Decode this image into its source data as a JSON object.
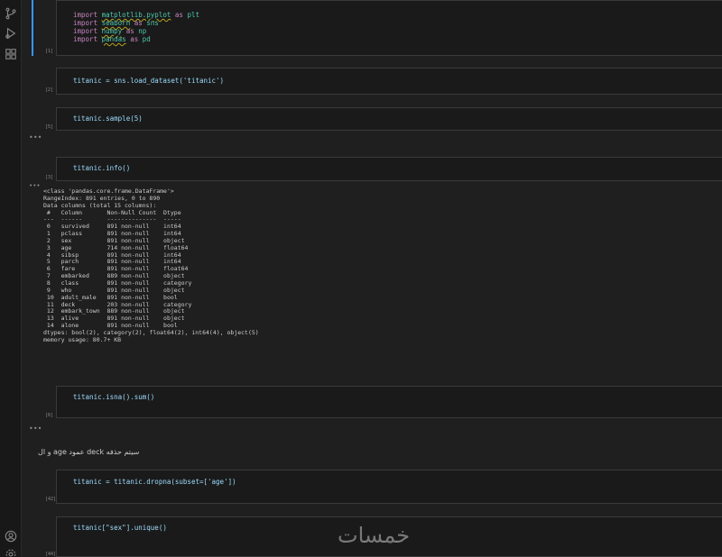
{
  "cells": [
    {
      "count": "[1]",
      "lines": [
        [
          "import",
          "matplotlib.pyplot",
          "as",
          "plt"
        ],
        [
          "import",
          "seaborn",
          "as",
          "sns"
        ],
        [
          "import",
          "numpy",
          "as",
          "np"
        ],
        [
          "import",
          "pandas",
          "as",
          "pd"
        ]
      ]
    },
    {
      "count": "[2]",
      "code": "titanic = sns.load_dataset('titanic')"
    },
    {
      "count": "[5]",
      "code": "titanic.sample(5)"
    },
    {
      "count": "[3]",
      "code": "titanic.info()"
    },
    {
      "count": "[6]",
      "code": "titanic.isna().sum()"
    },
    {
      "count": "[42]",
      "code": "titanic = titanic.dropna(subset=['age'])"
    },
    {
      "count": "[44]",
      "code": "titanic[\"sex\"].unique()"
    }
  ],
  "collapsed_marker": "•••",
  "info_output": "<class 'pandas.core.frame.DataFrame'>\nRangeIndex: 891 entries, 0 to 890\nData columns (total 15 columns):\n #   Column       Non-Null Count  Dtype   \n---  ------       --------------  -----   \n 0   survived     891 non-null    int64   \n 1   pclass       891 non-null    int64   \n 2   sex          891 non-null    object  \n 3   age          714 non-null    float64 \n 4   sibsp        891 non-null    int64   \n 5   parch        891 non-null    int64   \n 6   fare         891 non-null    float64 \n 7   embarked     889 non-null    object  \n 8   class        891 non-null    category\n 9   who          891 non-null    object  \n 10  adult_male   891 non-null    bool    \n 11  deck         203 non-null    category\n 12  embark_town  889 non-null    object  \n 13  alive        891 non-null    object  \n 14  alone        891 non-null    bool    \ndtypes: bool(2), category(2), float64(2), int64(4), object(5)\nmemory usage: 80.7+ KB",
  "markdown_text": "سيتم حذفه deck عمود age و ال",
  "watermark": "خمسات",
  "activity_icons": [
    "source-control-icon",
    "run-debug-icon",
    "extensions-icon",
    "account-icon",
    "settings-icon"
  ]
}
